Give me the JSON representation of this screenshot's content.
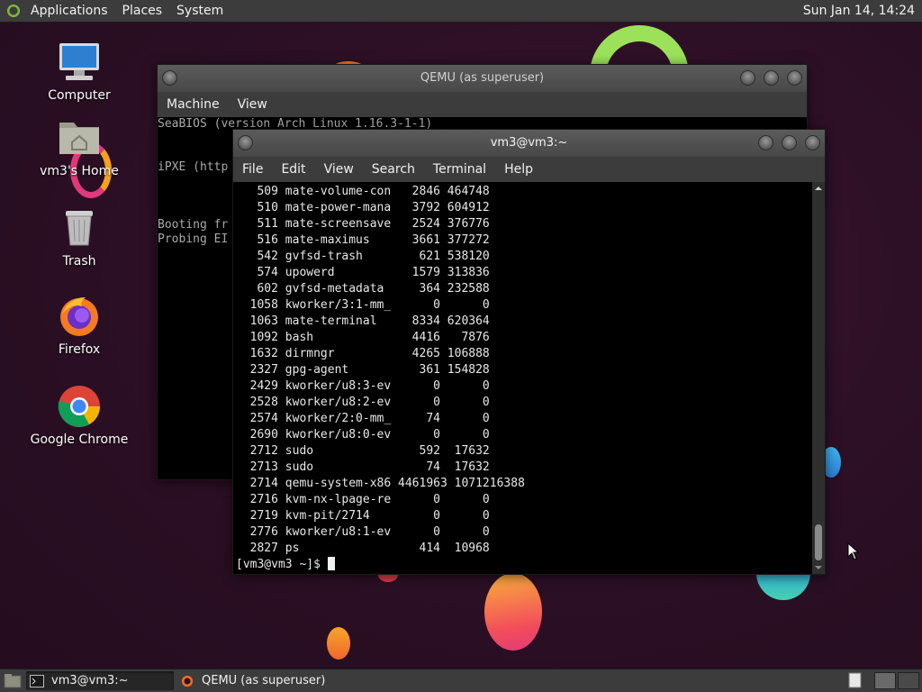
{
  "top_panel": {
    "menus": [
      "Applications",
      "Places",
      "System"
    ],
    "clock": "Sun Jan 14, 14:24"
  },
  "desktop_icons": [
    {
      "label": "Computer",
      "icon": "computer-icon"
    },
    {
      "label": "vm3's Home",
      "icon": "home-folder-icon"
    },
    {
      "label": "Trash",
      "icon": "trash-icon"
    },
    {
      "label": "Firefox",
      "icon": "firefox-icon"
    },
    {
      "label": "Google Chrome",
      "icon": "chrome-icon"
    }
  ],
  "qemu_window": {
    "title": "QEMU (as superuser)",
    "menus": [
      "Machine",
      "View"
    ],
    "console_lines": [
      "SeaBIOS (version Arch Linux 1.16.3-1-1)",
      "",
      "",
      "iPXE (http",
      "",
      "",
      "",
      "Booting fr",
      "Probing EI"
    ]
  },
  "terminal_window": {
    "title": "vm3@vm3:~",
    "menus": [
      "File",
      "Edit",
      "View",
      "Search",
      "Terminal",
      "Help"
    ],
    "lines": [
      "   509 mate-volume-con   2846 464748",
      "   510 mate-power-mana   3792 604912",
      "   511 mate-screensave   2524 376776",
      "   516 mate-maximus      3661 377272",
      "   542 gvfsd-trash        621 538120",
      "   574 upowerd           1579 313836",
      "   602 gvfsd-metadata     364 232588",
      "  1058 kworker/3:1-mm_      0      0",
      "  1063 mate-terminal     8334 620364",
      "  1092 bash              4416   7876",
      "  1632 dirmngr           4265 106888",
      "  2327 gpg-agent          361 154828",
      "  2429 kworker/u8:3-ev      0      0",
      "  2528 kworker/u8:2-ev      0      0",
      "  2574 kworker/2:0-mm_     74      0",
      "  2690 kworker/u8:0-ev      0      0",
      "  2712 sudo               592  17632",
      "  2713 sudo                74  17632",
      "  2714 qemu-system-x86 4461963 1071216388",
      "  2716 kvm-nx-lpage-re      0      0",
      "  2719 kvm-pit/2714         0      0",
      "  2776 kworker/u8:1-ev      0      0",
      "  2827 ps                 414  10968"
    ],
    "prompt": "[vm3@vm3 ~]$ "
  },
  "taskbar": {
    "tasks": [
      {
        "label": "vm3@vm3:~",
        "icon": "terminal-icon",
        "active": true
      },
      {
        "label": "QEMU (as superuser)",
        "icon": "qemu-icon",
        "active": false
      }
    ]
  }
}
